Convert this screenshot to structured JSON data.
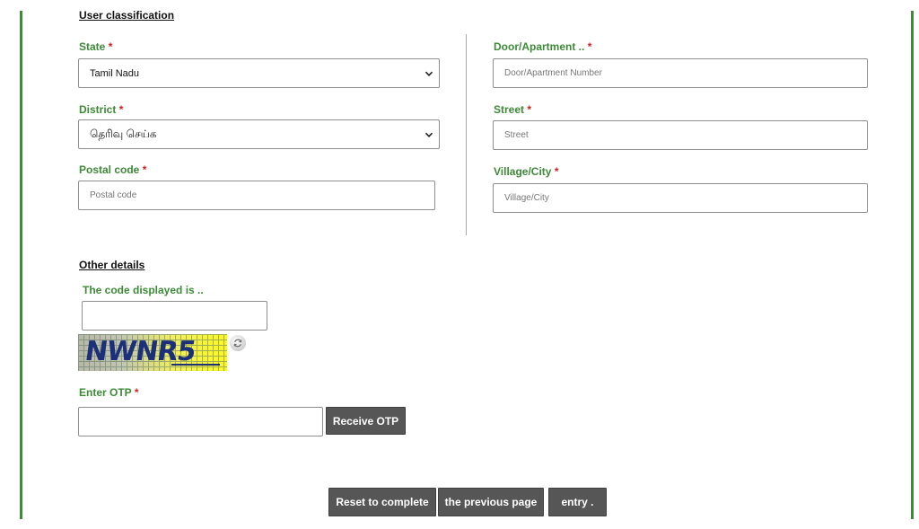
{
  "sections": {
    "user_classification": "User classification",
    "other_details": "Other details"
  },
  "left": {
    "state": {
      "label": "State",
      "value": "Tamil Nadu"
    },
    "district": {
      "label": "District",
      "value": "தெரிவு செய்க"
    },
    "postal": {
      "label": "Postal code",
      "placeholder": "Postal code"
    }
  },
  "right": {
    "door": {
      "label": "Door/Apartment ..",
      "placeholder": "Door/Apartment Number"
    },
    "street": {
      "label": "Street",
      "placeholder": "Street"
    },
    "village": {
      "label": "Village/City",
      "placeholder": "Village/City"
    }
  },
  "required_mark": "*",
  "captcha": {
    "label": "The code displayed is ..",
    "input_value": "",
    "image_text": "NWNR5"
  },
  "otp": {
    "label": "Enter OTP",
    "input_value": "",
    "button": "Receive OTP"
  },
  "actions": {
    "reset": "Reset to complete",
    "previous": "the previous page",
    "entry": "entry ."
  },
  "colors": {
    "label_green": "#3d8a37",
    "required_red": "#d01f1f",
    "button_gray": "#565656"
  },
  "icons": {
    "dropdown": "chevron-down-icon",
    "refresh": "refresh-icon"
  }
}
